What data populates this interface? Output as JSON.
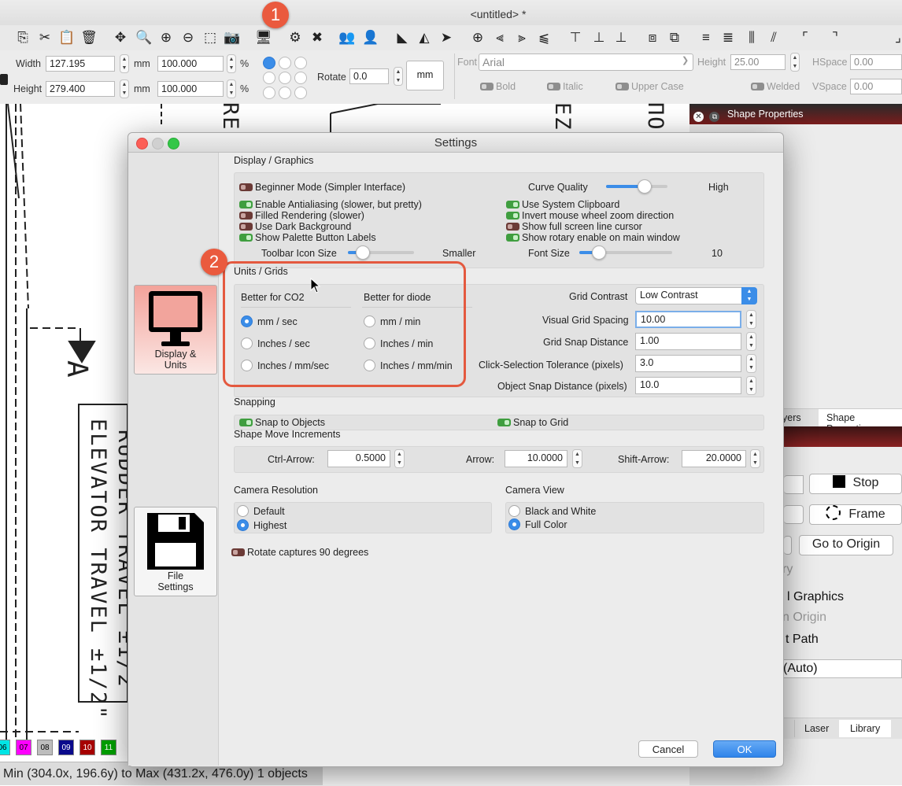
{
  "app": {
    "window_title": "<untitled> *",
    "status": "Min (304.0x, 196.6y) to Max (431.2x, 476.0y)  1 objects"
  },
  "toolbar": {
    "icons": [
      "copy-icon",
      "cut-icon",
      "paste-icon",
      "delete-icon",
      "move-icon",
      "zoom-selection-icon",
      "zoom-in-icon",
      "zoom-out-icon",
      "select-rect-icon",
      "camera-icon",
      "device-icon",
      "settings-icon",
      "tools-icon",
      "group-icon",
      "user-icon",
      "flip-h-icon",
      "mirror-icon",
      "send-icon",
      "target-icon",
      "align-left-icon",
      "align-center-icon",
      "align-right-icon",
      "align-top-icon",
      "align-middle-icon",
      "align-bottom-icon",
      "distribute-h-icon",
      "distribute-v-icon",
      "dist-icon-1",
      "dist-icon-2",
      "dist-icon-3",
      "dist-icon-4",
      "corner-icon-1",
      "corner-icon-2",
      "corner-icon-3"
    ]
  },
  "props": {
    "width_label": "Width",
    "width_value": "127.195",
    "width_unit": "mm",
    "width_pct": "100.000",
    "pct": "%",
    "height_label": "Height",
    "height_value": "279.400",
    "height_unit": "mm",
    "height_pct": "100.000",
    "rotate_label": "Rotate",
    "rotate_value": "0.0",
    "unit_button": "mm",
    "font_label": "Font",
    "font_value": "Arial",
    "font_height_label": "Height",
    "font_height_value": "25.00",
    "hspace_label": "HSpace",
    "hspace_value": "0.00",
    "vspace_label": "VSpace",
    "vspace_value": "0.00",
    "bold": "Bold",
    "italic": "Italic",
    "upper": "Upper Case",
    "welded": "Welded"
  },
  "drawing": {
    "texts": [
      "RUDDER TRAVEL ±1/2",
      "ELEVATOR TRAVEL ±1/2\"",
      "A",
      "RE",
      "EZ",
      "ΠΟ"
    ]
  },
  "palette": [
    "06",
    "07",
    "08",
    "09",
    "10",
    "11"
  ],
  "palette_colors": [
    "#00e5e5",
    "#ff00ff",
    "#bdbdbd",
    "#0a0a8c",
    "#a60000",
    "#00a000"
  ],
  "dock": {
    "header": "Shape Properties",
    "tabs": [
      "yers",
      "Shape Properties"
    ],
    "stop": "Stop",
    "frame": "Frame",
    "origin": "Go to Origin",
    "texts": [
      "ry",
      "l Graphics",
      "n Origin",
      "t Path",
      "(Auto)"
    ],
    "bottom_tabs": [
      "Laser",
      "Library"
    ]
  },
  "dialog": {
    "title": "Settings",
    "sidebar": [
      {
        "label": "Display &",
        "label2": "Units"
      },
      {
        "label": "File",
        "label2": "Settings"
      }
    ],
    "display_graphics": {
      "title": "Display / Graphics",
      "beginner": "Beginner Mode (Simpler Interface)",
      "curve_quality": "Curve Quality",
      "curve_quality_level": "High",
      "left_options": [
        "Enable Antialiasing (slower, but pretty)",
        "Filled Rendering (slower)",
        "Use Dark Background",
        "Show Palette Button Labels"
      ],
      "right_options": [
        "Use System Clipboard",
        "Invert mouse wheel zoom direction",
        "Show full screen line cursor",
        "Show rotary enable on main window"
      ],
      "icon_size_label": "Toolbar Icon Size",
      "icon_size_value": "Smaller",
      "font_size_label": "Font Size",
      "font_size_value": "10"
    },
    "units_grids": {
      "title": "Units / Grids",
      "co2_header": "Better for CO2",
      "diode_header": "Better for diode",
      "co2_options": [
        "mm / sec",
        "Inches / sec",
        "Inches / mm/sec"
      ],
      "diode_options": [
        "mm / min",
        "Inches / min",
        "Inches / mm/min"
      ],
      "grid_contrast_label": "Grid Contrast",
      "grid_contrast_value": "Low Contrast",
      "grid_spacing_label": "Visual Grid Spacing",
      "grid_spacing_value": "10.00",
      "snap_distance_label": "Grid Snap Distance",
      "snap_distance_value": "1.00",
      "click_tol_label": "Click-Selection Tolerance (pixels)",
      "click_tol_value": "3.0",
      "obj_snap_label": "Object Snap Distance (pixels)",
      "obj_snap_value": "10.0"
    },
    "snapping": {
      "title": "Snapping",
      "snap_objects": "Snap to Objects",
      "snap_grid": "Snap to Grid"
    },
    "increments": {
      "title": "Shape Move Increments",
      "ctrl_label": "Ctrl-Arrow:",
      "ctrl_value": "0.5000",
      "arrow_label": "Arrow:",
      "arrow_value": "10.0000",
      "shift_label": "Shift-Arrow:",
      "shift_value": "20.0000"
    },
    "camera": {
      "res_title": "Camera Resolution",
      "res_default": "Default",
      "res_highest": "Highest",
      "view_title": "Camera View",
      "view_bw": "Black and White",
      "view_color": "Full Color",
      "rotate": "Rotate captures 90 degrees"
    },
    "cancel": "Cancel",
    "ok": "OK"
  },
  "callouts": [
    "1",
    "2"
  ]
}
